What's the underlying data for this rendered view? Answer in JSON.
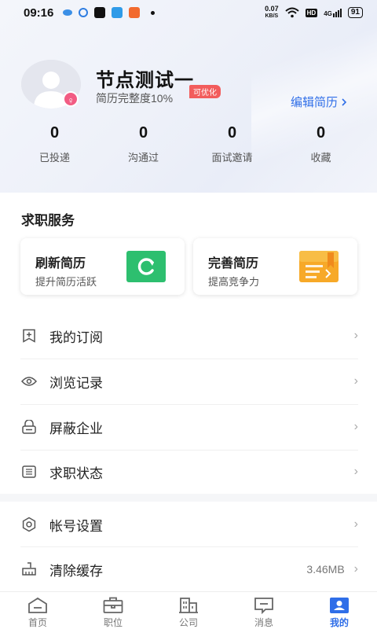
{
  "status_bar": {
    "time": "09:16",
    "net_speed_value": "0.07",
    "net_speed_unit": "KB/S",
    "hd": "HD",
    "signal": "4G",
    "battery": "91"
  },
  "profile": {
    "name": "节点测试一",
    "completeness": "简历完整度10%",
    "optimize_tag": "可优化",
    "edit_label": "编辑简历",
    "gender_symbol": "♀"
  },
  "stats": [
    {
      "value": "0",
      "label": "已投递"
    },
    {
      "value": "0",
      "label": "沟通过"
    },
    {
      "value": "0",
      "label": "面试邀请"
    },
    {
      "value": "0",
      "label": "收藏"
    }
  ],
  "services": {
    "title": "求职服务",
    "cards": [
      {
        "title": "刷新简历",
        "subtitle": "提升简历活跃",
        "icon": "refresh-icon",
        "color": "#2dbf6f"
      },
      {
        "title": "完善简历",
        "subtitle": "提高竞争力",
        "icon": "document-icon",
        "color": "#f7a928"
      }
    ]
  },
  "menu": [
    {
      "label": "我的订阅",
      "icon": "bookmark-plus-icon"
    },
    {
      "label": "浏览记录",
      "icon": "eye-icon"
    },
    {
      "label": "屏蔽企业",
      "icon": "block-icon"
    },
    {
      "label": "求职状态",
      "icon": "list-icon"
    }
  ],
  "settings": [
    {
      "label": "帐号设置",
      "icon": "gear-icon",
      "value": ""
    },
    {
      "label": "清除缓存",
      "icon": "broom-icon",
      "value": "3.46MB"
    }
  ],
  "bottom_nav": [
    {
      "label": "首页",
      "icon": "home-icon",
      "active": false
    },
    {
      "label": "职位",
      "icon": "briefcase-icon",
      "active": false
    },
    {
      "label": "公司",
      "icon": "building-icon",
      "active": false
    },
    {
      "label": "消息",
      "icon": "message-icon",
      "active": false
    },
    {
      "label": "我的",
      "icon": "profile-icon",
      "active": true
    }
  ],
  "colors": {
    "accent": "#2f6ee8",
    "tag_red": "#f25c5c",
    "female_pink": "#f25c83"
  }
}
